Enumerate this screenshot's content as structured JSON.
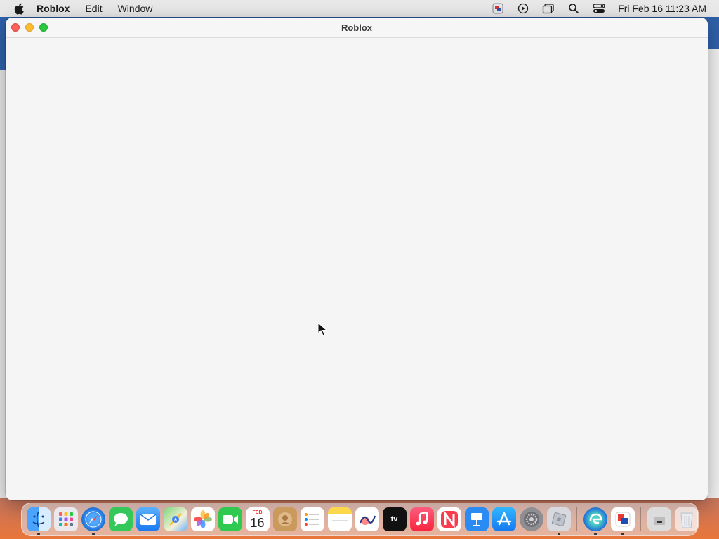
{
  "menubar": {
    "app_name": "Roblox",
    "items": [
      "Edit",
      "Window"
    ],
    "clock": "Fri Feb 16  11:23 AM",
    "status_icons": [
      "parallels-icon",
      "play-circle-icon",
      "window-switch-icon",
      "search-icon",
      "control-center-icon"
    ]
  },
  "window": {
    "title": "Roblox"
  },
  "dock": {
    "apps": [
      "Finder",
      "Launchpad",
      "Safari",
      "Messages",
      "Mail",
      "Maps",
      "Photos",
      "FaceTime",
      "Calendar",
      "Contacts",
      "Reminders",
      "Notes",
      "Freeform",
      "TV",
      "Music",
      "News",
      "Keynote",
      "App Store",
      "System Settings",
      "Roblox",
      "Microsoft Edge",
      "Parallels",
      "Downloads",
      "Trash"
    ],
    "calendar_month": "FEB",
    "calendar_day": "16",
    "tv_label": "tv"
  }
}
